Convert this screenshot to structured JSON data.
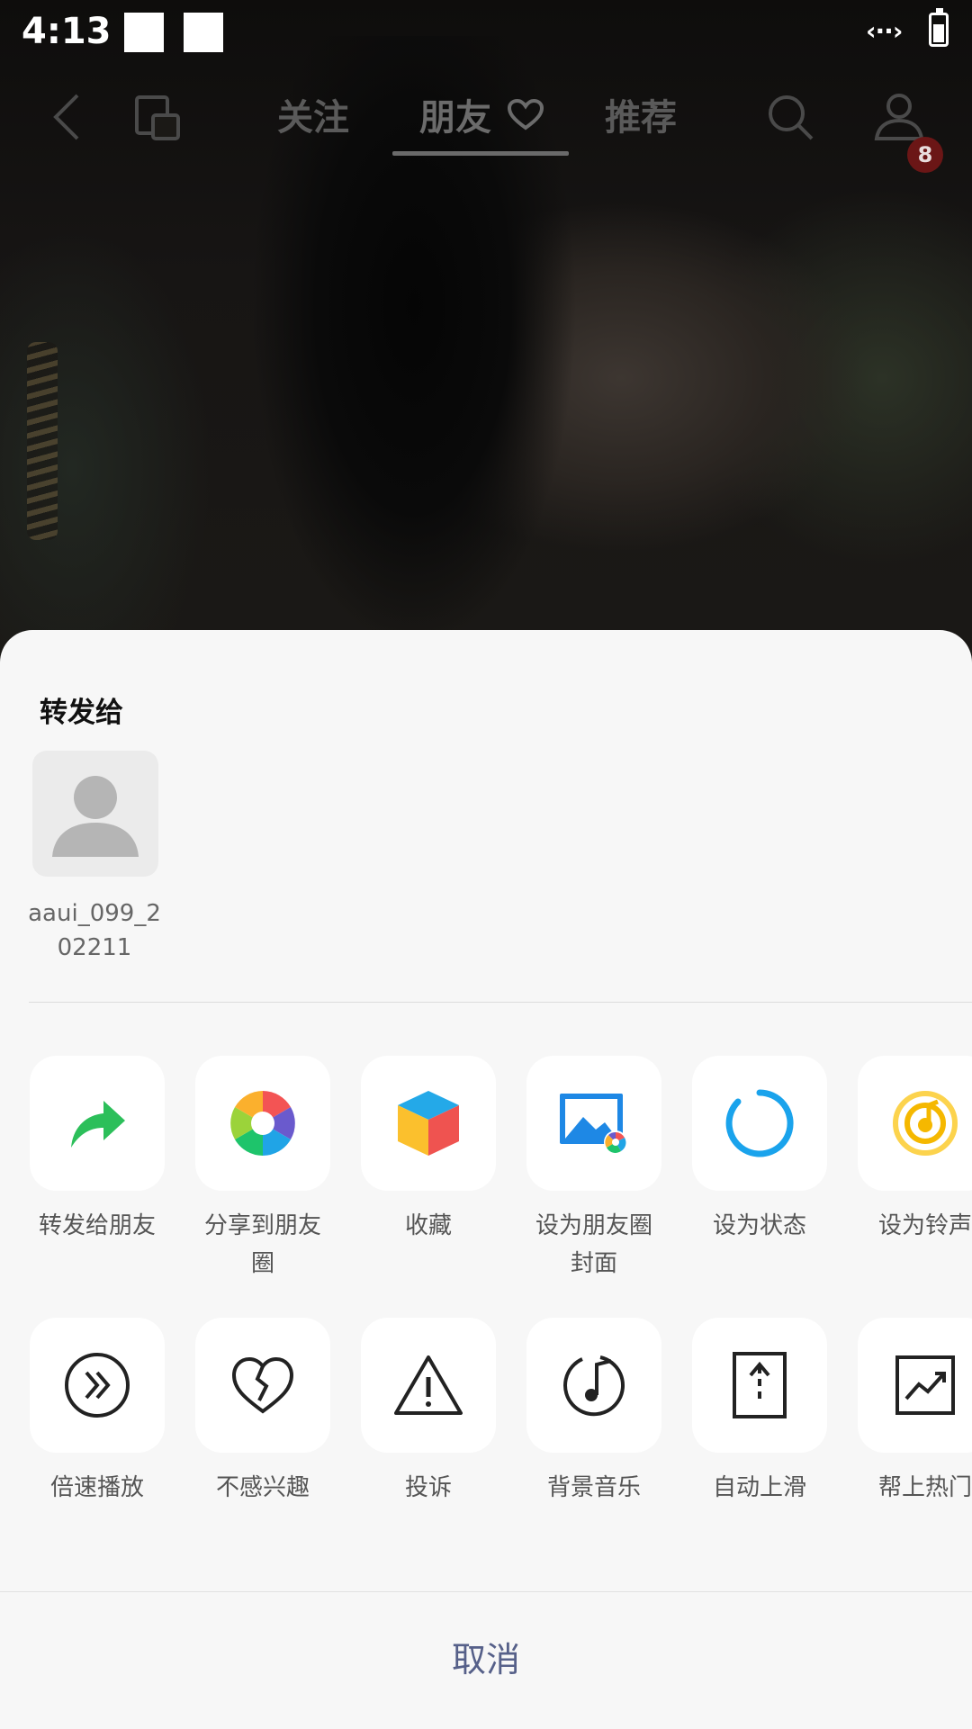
{
  "status_bar": {
    "time": "4:13"
  },
  "top_nav": {
    "tabs": [
      {
        "label": "关注"
      },
      {
        "label": "朋友"
      },
      {
        "label": "推荐"
      }
    ],
    "notification_count": "8"
  },
  "share_sheet": {
    "title": "转发给",
    "contacts": [
      {
        "name": "aaui_099_202211"
      }
    ],
    "row1": [
      {
        "label": "转发给朋友",
        "icon": "forward-arrow-icon"
      },
      {
        "label": "分享到朋友圈",
        "icon": "moments-aperture-icon"
      },
      {
        "label": "收藏",
        "icon": "favorites-cube-icon"
      },
      {
        "label": "设为朋友圈封面",
        "icon": "moments-cover-icon"
      },
      {
        "label": "设为状态",
        "icon": "status-ring-icon"
      },
      {
        "label": "设为铃声",
        "icon": "ringtone-icon"
      }
    ],
    "row2": [
      {
        "label": "倍速播放",
        "icon": "playback-speed-icon"
      },
      {
        "label": "不感兴趣",
        "icon": "broken-heart-icon"
      },
      {
        "label": "投诉",
        "icon": "warning-icon"
      },
      {
        "label": "背景音乐",
        "icon": "music-note-icon"
      },
      {
        "label": "自动上滑",
        "icon": "auto-scroll-icon"
      },
      {
        "label": "帮上热门",
        "icon": "trending-icon"
      }
    ],
    "cancel_label": "取消"
  }
}
